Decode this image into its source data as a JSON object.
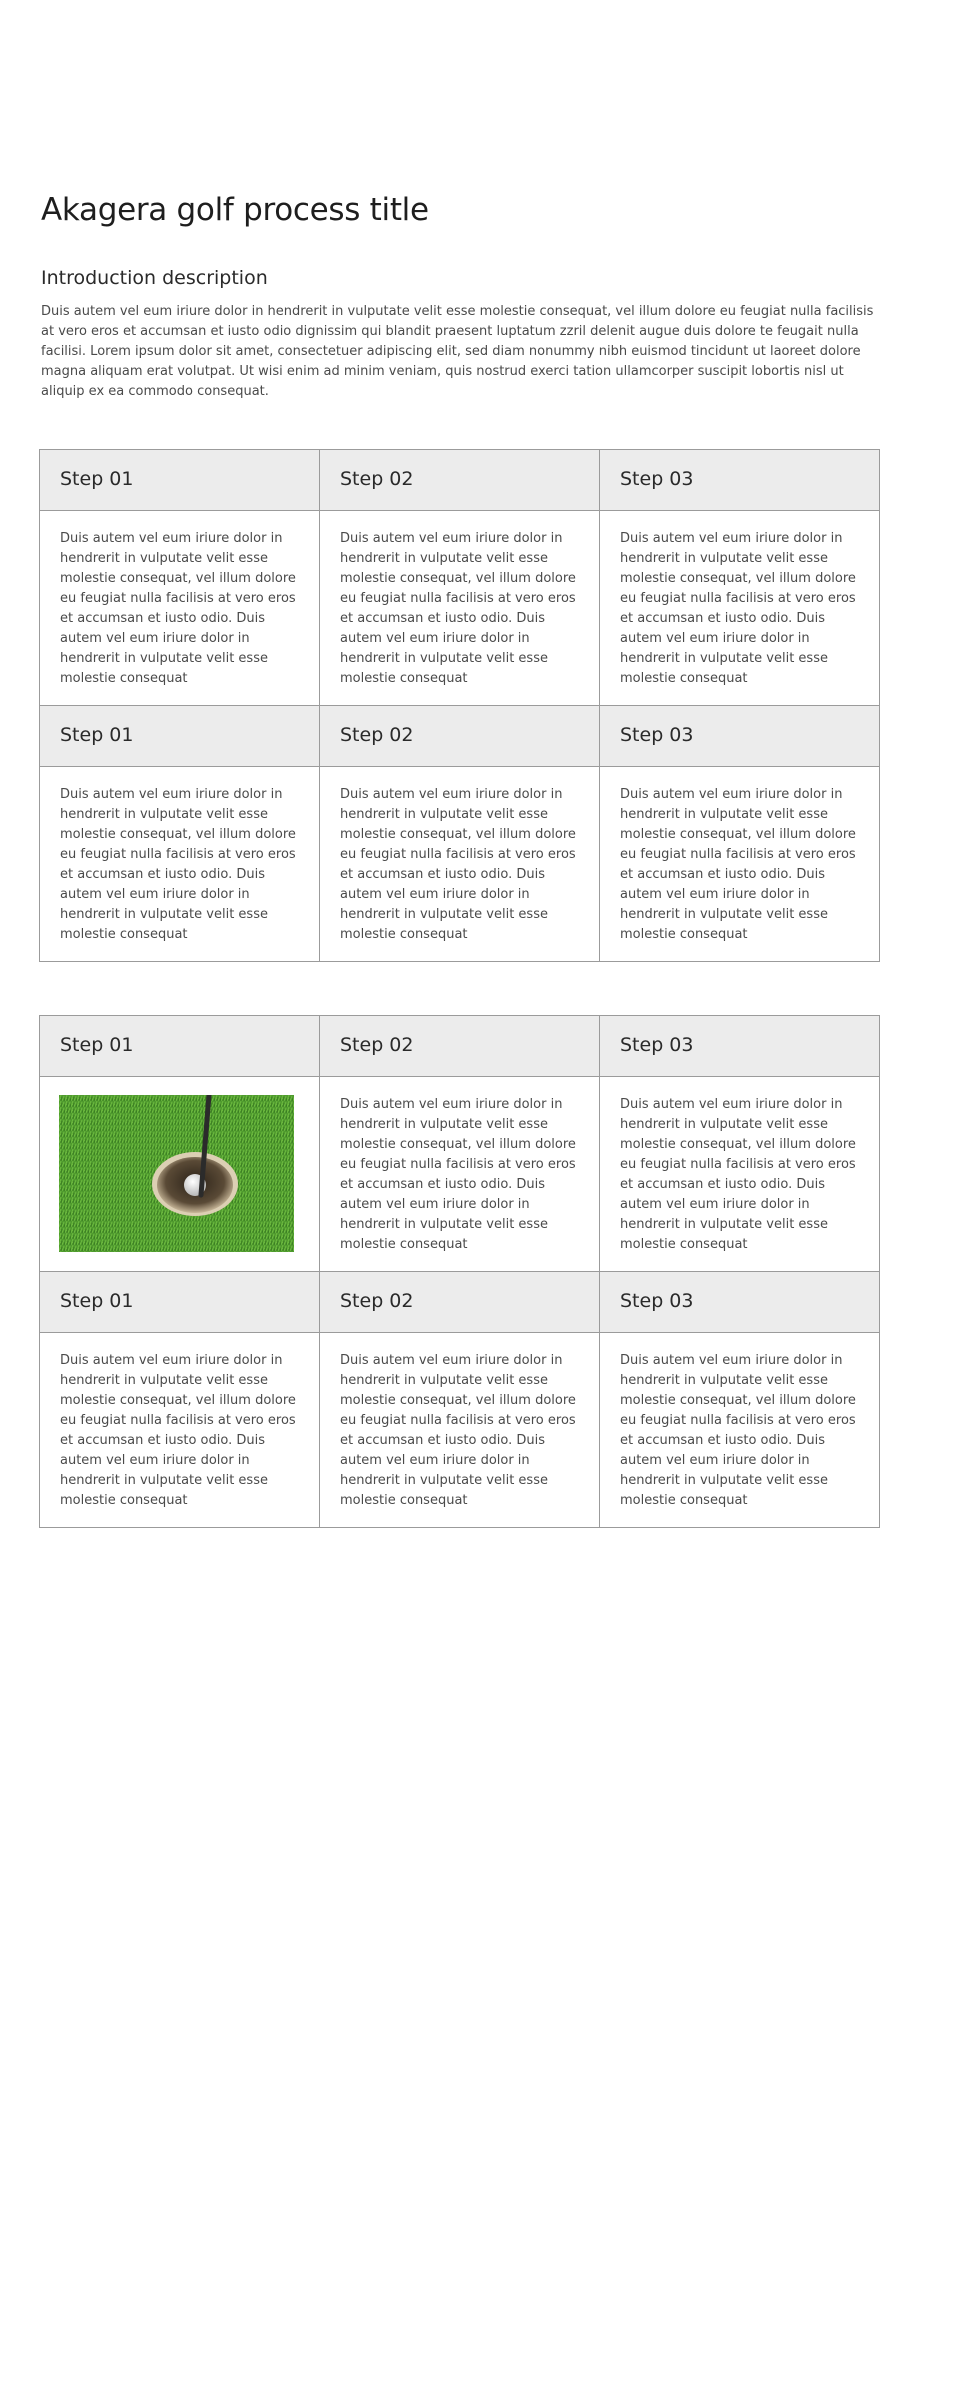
{
  "page": {
    "title": "Akagera golf process title",
    "intro_heading": "Introduction description",
    "intro_text": "Duis autem vel eum iriure dolor in hendrerit in vulputate velit esse molestie consequat, vel illum dolore eu feugiat nulla facilisis at vero eros et accumsan et iusto odio dignissim qui blandit praesent luptatum zzril delenit augue duis dolore te feugait nulla facilisi. Lorem ipsum dolor sit amet, consectetuer adipiscing elit, sed diam nonummy nibh euismod tincidunt ut laoreet dolore magna aliquam erat volutpat. Ut wisi enim ad minim veniam, quis nostrud exerci tation ullamcorper suscipit lobortis nisl ut aliquip ex ea commodo consequat."
  },
  "table1": {
    "rows": [
      {
        "headers": [
          "Step 01",
          "Step 02",
          "Step 03"
        ],
        "bodies": [
          "Duis autem vel eum iriure dolor in hendrerit in vulputate velit esse molestie consequat, vel illum dolore eu feugiat nulla facilisis at vero eros et accumsan et iusto odio. Duis autem vel eum iriure dolor in hendrerit in vulputate velit esse molestie consequat",
          "Duis autem vel eum iriure dolor in hendrerit in vulputate velit esse molestie consequat, vel illum dolore eu feugiat nulla facilisis at vero eros et accumsan et iusto odio. Duis autem vel eum iriure dolor in hendrerit in vulputate velit esse molestie consequat",
          "Duis autem vel eum iriure dolor in hendrerit in vulputate velit esse molestie consequat, vel illum dolore eu feugiat nulla facilisis at vero eros et accumsan et iusto odio. Duis autem vel eum iriure dolor in hendrerit in vulputate velit esse molestie consequat"
        ]
      },
      {
        "headers": [
          "Step 01",
          "Step 02",
          "Step 03"
        ],
        "bodies": [
          "Duis autem vel eum iriure dolor in hendrerit in vulputate velit esse molestie consequat, vel illum dolore eu feugiat nulla facilisis at vero eros et accumsan et iusto odio. Duis autem vel eum iriure dolor in hendrerit in vulputate velit esse molestie consequat",
          "Duis autem vel eum iriure dolor in hendrerit in vulputate velit esse molestie consequat, vel illum dolore eu feugiat nulla facilisis at vero eros et accumsan et iusto odio. Duis autem vel eum iriure dolor in hendrerit in vulputate velit esse molestie consequat",
          "Duis autem vel eum iriure dolor in hendrerit in vulputate velit esse molestie consequat, vel illum dolore eu feugiat nulla facilisis at vero eros et accumsan et iusto odio. Duis autem vel eum iriure dolor in hendrerit in vulputate velit esse molestie consequat"
        ]
      }
    ]
  },
  "table2": {
    "rows": [
      {
        "headers": [
          "Step 01",
          "Step 02",
          "Step 03"
        ],
        "image": "golf-hole-image",
        "bodies": [
          "",
          "Duis autem vel eum iriure dolor in hendrerit in vulputate velit esse molestie consequat, vel illum dolore eu feugiat nulla facilisis at vero eros et accumsan et iusto odio. Duis autem vel eum iriure dolor in hendrerit in vulputate velit esse molestie consequat",
          "Duis autem vel eum iriure dolor in hendrerit in vulputate velit esse molestie consequat, vel illum dolore eu feugiat nulla facilisis at vero eros et accumsan et iusto odio. Duis autem vel eum iriure dolor in hendrerit in vulputate velit esse molestie consequat"
        ]
      },
      {
        "headers": [
          "Step 01",
          "Step 02",
          "Step 03"
        ],
        "bodies": [
          "Duis autem vel eum iriure dolor in hendrerit in vulputate velit esse molestie consequat, vel illum dolore eu feugiat nulla facilisis at vero eros et accumsan et iusto odio. Duis autem vel eum iriure dolor in hendrerit in vulputate velit esse molestie consequat",
          "Duis autem vel eum iriure dolor in hendrerit in vulputate velit esse molestie consequat, vel illum dolore eu feugiat nulla facilisis at vero eros et accumsan et iusto odio. Duis autem vel eum iriure dolor in hendrerit in vulputate velit esse molestie consequat",
          "Duis autem vel eum iriure dolor in hendrerit in vulputate velit esse molestie consequat, vel illum dolore eu feugiat nulla facilisis at vero eros et accumsan et iusto odio. Duis autem vel eum iriure dolor in hendrerit in vulputate velit esse molestie consequat"
        ]
      }
    ]
  },
  "colors": {
    "header_bg": "#ececec",
    "border": "#9b9b9b",
    "title": "#1e1e1e",
    "body_text": "#4a4a4a"
  }
}
